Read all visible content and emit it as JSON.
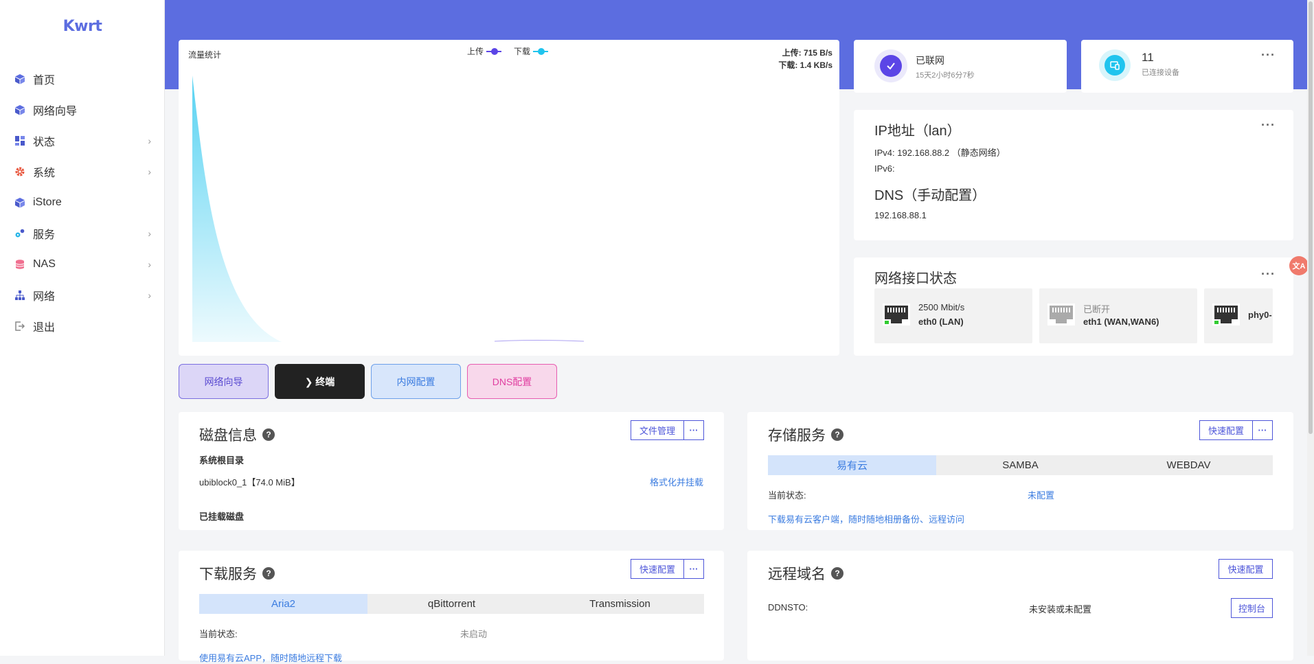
{
  "brand": {
    "logo_text": "Kwrt"
  },
  "sidebar": {
    "items": [
      {
        "label": "首页",
        "icon": "cube-icon",
        "has_children": false
      },
      {
        "label": "网络向导",
        "icon": "cube-icon",
        "has_children": false
      },
      {
        "label": "状态",
        "icon": "dashboard-icon",
        "has_children": true
      },
      {
        "label": "系统",
        "icon": "gear-icon",
        "has_children": true
      },
      {
        "label": "iStore",
        "icon": "cube-icon",
        "has_children": false
      },
      {
        "label": "服务",
        "icon": "services-icon",
        "has_children": true
      },
      {
        "label": "NAS",
        "icon": "database-icon",
        "has_children": true
      },
      {
        "label": "网络",
        "icon": "network-icon",
        "has_children": true
      },
      {
        "label": "退出",
        "icon": "logout-icon",
        "has_children": false
      }
    ]
  },
  "traffic": {
    "title": "流量统计",
    "legend_upload": "上传",
    "legend_download": "下载",
    "upload_speed": "上传: 715 B/s",
    "download_speed": "下载: 1.4 KB/s",
    "colors": {
      "upload": "#5b45e6",
      "download": "#20c4ee"
    }
  },
  "quick_buttons": [
    {
      "label": "网络向导"
    },
    {
      "label": "❯ 终端"
    },
    {
      "label": "内网配置"
    },
    {
      "label": "DNS配置"
    }
  ],
  "status_card": {
    "title": "已联网",
    "subtitle": "15天2小时6分7秒"
  },
  "devices_card": {
    "count": "11",
    "label": "已连接设备"
  },
  "ip_card": {
    "title": "IP地址（lan）",
    "ipv4": "IPv4: 192.168.88.2 （静态网络）",
    "ipv6": "IPv6:",
    "dns_title": "DNS（手动配置）",
    "dns_value": "192.168.88.1"
  },
  "iface_card": {
    "title": "网络接口状态",
    "interfaces": [
      {
        "line1": "2500 Mbit/s",
        "line2": "eth0 (LAN)",
        "connected": true
      },
      {
        "line1": "已断开",
        "line2": "eth1 (WAN,WAN6)",
        "connected": false
      },
      {
        "line1": "",
        "line2": "phy0-",
        "connected": true
      }
    ]
  },
  "disk": {
    "title": "磁盘信息",
    "file_mgmt": "文件管理",
    "root_label": "系统根目录",
    "root_value": "ubiblock0_1【74.0 MiB】",
    "format_link": "格式化并挂载",
    "mounted_label": "已挂载磁盘"
  },
  "storage": {
    "title": "存储服务",
    "quick_config": "快速配置",
    "tabs": [
      "易有云",
      "SAMBA",
      "WEBDAV"
    ],
    "status_label": "当前状态:",
    "status_value": "未配置",
    "link": "下载易有云客户端，随时随地相册备份、远程访问"
  },
  "download": {
    "title": "下载服务",
    "quick_config": "快速配置",
    "tabs": [
      "Aria2",
      "qBittorrent",
      "Transmission"
    ],
    "status_label": "当前状态:",
    "status_value": "未启动",
    "link": "使用易有云APP，随时随地远程下载"
  },
  "remote": {
    "title": "远程域名",
    "quick_config": "快速配置",
    "ddnsto_label": "DDNSTO:",
    "ddnsto_status": "未安装或未配置",
    "console": "控制台"
  }
}
